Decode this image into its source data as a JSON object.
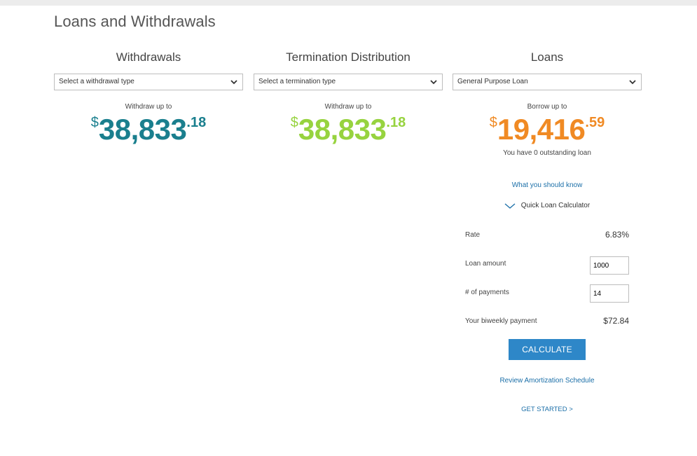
{
  "page_title": "Loans and Withdrawals",
  "withdrawals": {
    "title": "Withdrawals",
    "select_value": "Select a withdrawal type",
    "amount_label": "Withdraw up to",
    "currency": "$",
    "amount_main": "38,833",
    "amount_cents": ".18",
    "color": "#1a7f8e"
  },
  "termination": {
    "title": "Termination Distribution",
    "select_value": "Select a termination type",
    "amount_label": "Withdraw up to",
    "currency": "$",
    "amount_main": "38,833",
    "amount_cents": ".18",
    "color": "#97d33f"
  },
  "loans": {
    "title": "Loans",
    "select_value": "General Purpose Loan",
    "amount_label": "Borrow up to",
    "currency": "$",
    "amount_main": "19,416",
    "amount_cents": ".59",
    "color": "#f08a24",
    "outstanding": "You have 0 outstanding loan",
    "what_to_know": "What you should know",
    "quick_calc": "Quick Loan Calculator",
    "calculator": {
      "rate_label": "Rate",
      "rate_value": "6.83%",
      "amount_label": "Loan amount",
      "amount_value": "1000",
      "payments_label": "# of payments",
      "payments_value": "14",
      "payment_label": "Your biweekly payment",
      "payment_value": "$72.84"
    },
    "calculate_button": "CALCULATE",
    "review_link": "Review Amortization Schedule",
    "get_started": "GET STARTED >"
  }
}
